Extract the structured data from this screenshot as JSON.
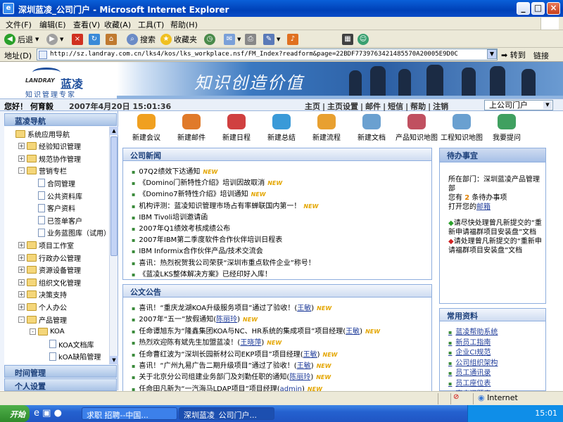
{
  "window": {
    "title": "深圳蓝凌_公司门户 - Microsoft Internet Explorer"
  },
  "menu": [
    "文件(F)",
    "编辑(E)",
    "查看(V)",
    "收藏(A)",
    "工具(T)",
    "帮助(H)"
  ],
  "toolbar": {
    "back": "后退",
    "search": "搜索",
    "favorites": "收藏夹"
  },
  "address": {
    "label": "地址(D)",
    "url": "http://sz.landray.com.cn/lks4/kos/lks_workplace.nsf/FM_Index?readform&page=22BDF7739763421485570A20005E9D0C",
    "go": "转到",
    "links": "链接"
  },
  "brand": {
    "logo_en": "LANDRAY",
    "logo_cn": "蓝凌",
    "tagline": "知识管理专家",
    "calligraphy": "知识创造价值"
  },
  "strip": {
    "greeting": "您好！ 何育毅",
    "datetime": "2007年4月20日 15:01:36",
    "nav": [
      "主页",
      "主页设置",
      "邮件",
      "短信",
      "帮助",
      "注销"
    ],
    "portal_select": "上公司门户"
  },
  "leftnav": {
    "header": "蓝凌导航",
    "footer1": "时间管理",
    "footer2": "个人设置",
    "tree": [
      {
        "label": "系统应用导航",
        "level": 0,
        "icon": "folder",
        "pm": ""
      },
      {
        "label": "经验知识管理",
        "level": 1,
        "icon": "folder",
        "pm": "+"
      },
      {
        "label": "规范协作管理",
        "level": 1,
        "icon": "folder",
        "pm": "+"
      },
      {
        "label": "营销专栏",
        "level": 1,
        "icon": "folder",
        "pm": "-"
      },
      {
        "label": "合同管理",
        "level": 2,
        "icon": "doc",
        "pm": ""
      },
      {
        "label": "公共资料库",
        "level": 2,
        "icon": "doc",
        "pm": ""
      },
      {
        "label": "客户资料",
        "level": 2,
        "icon": "doc",
        "pm": ""
      },
      {
        "label": "已签单客户",
        "level": 2,
        "icon": "doc",
        "pm": ""
      },
      {
        "label": "业务蓝图库（试用）",
        "level": 2,
        "icon": "doc",
        "pm": ""
      },
      {
        "label": "项目工作室",
        "level": 1,
        "icon": "folder",
        "pm": "+"
      },
      {
        "label": "行政办公管理",
        "level": 1,
        "icon": "folder",
        "pm": "+"
      },
      {
        "label": "资源设备管理",
        "level": 1,
        "icon": "folder",
        "pm": "+"
      },
      {
        "label": "组织文化管理",
        "level": 1,
        "icon": "folder",
        "pm": "+"
      },
      {
        "label": "决策支持",
        "level": 1,
        "icon": "folder",
        "pm": "+"
      },
      {
        "label": "个人办公",
        "level": 1,
        "icon": "folder",
        "pm": "+"
      },
      {
        "label": "产品管理",
        "level": 1,
        "icon": "folder",
        "pm": "-"
      },
      {
        "label": "KOA",
        "level": 2,
        "icon": "folder",
        "pm": "-"
      },
      {
        "label": "KOA文档库",
        "level": 3,
        "icon": "doc",
        "pm": ""
      },
      {
        "label": "kOA缺陷管理",
        "level": 3,
        "icon": "doc",
        "pm": ""
      }
    ]
  },
  "quick": [
    {
      "label": "新建会议",
      "color": "#f0a020"
    },
    {
      "label": "新建邮件",
      "color": "#e07a2a"
    },
    {
      "label": "新建日程",
      "color": "#d04040"
    },
    {
      "label": "新建总结",
      "color": "#3a9ad8"
    },
    {
      "label": "新建流程",
      "color": "#e8a030"
    },
    {
      "label": "新建文档",
      "color": "#6aa0d0"
    },
    {
      "label": "产品知识地图",
      "color": "#c05060"
    },
    {
      "label": "工程知识地图",
      "color": "#6aa0d0"
    },
    {
      "label": "我要提问",
      "color": "#40a060"
    }
  ],
  "news": {
    "title": "公司新闻",
    "items": [
      {
        "text": "07Q2绩效下达通知",
        "new": "NEW"
      },
      {
        "text": "《Domino门新特性介绍》培训因故取消",
        "new": "NEW"
      },
      {
        "text": "《Domino7新特性介绍》培训通知",
        "new": "NEW"
      },
      {
        "text": "机构评测：蓝凌知识管理市场占有率蝉联国内第一！",
        "new": "NEW"
      },
      {
        "text": "IBM Tivoli培训邀请函",
        "new": ""
      },
      {
        "text": "2007年Q1绩效考核成绩公布",
        "new": ""
      },
      {
        "text": "2007年IBM第二季度软件合作伙伴培训日程表",
        "new": ""
      },
      {
        "text": "IBM Informix合作伙伴产品/技术交流会",
        "new": ""
      },
      {
        "text": "喜讯：热烈祝贺我公司荣获“深圳市重点软件企业”称号！",
        "new": ""
      },
      {
        "text": "《蓝凌LKS整体解决方案》已经印好入库！",
        "new": ""
      }
    ]
  },
  "notices": {
    "title": "公文公告",
    "items": [
      {
        "text": "喜讯！“重庆龙湖KOA升级服务项目”通过了验收！",
        "user": "王敏",
        "new": "NEW"
      },
      {
        "text": "2007年“五一”放假通知",
        "user": "陈丽玲",
        "new": "NEW"
      },
      {
        "text": "任命谭旭东为“隆鑫集团KOA与NC、HR系统的集成项目”项目经理",
        "user": "王敏",
        "new": "NEW"
      },
      {
        "text": "热烈欢迎陈有斌先生加盟蓝凌！",
        "user": "王晓萍",
        "new": "NEW"
      },
      {
        "text": "任命曹红波为“深圳长园新材公司EKP项目”项目经理",
        "user": "王敏",
        "new": "NEW"
      },
      {
        "text": "喜讯！“广州九易广告二期升级项目”通过了验收！",
        "user": "王敏",
        "new": "NEW"
      },
      {
        "text": "关于北京分公司组建业务部门及刘勤任职的通知",
        "user": "陈丽玲",
        "new": "NEW"
      },
      {
        "text": "任命田凡新为“一汽海马LDAP项目”项目经理",
        "user": "admin",
        "new": "NEW"
      }
    ]
  },
  "todo": {
    "title": "待办事宜",
    "dept": "所在部门：深圳蓝凌产品管理部",
    "count_pre": "您有",
    "count": "2",
    "count_post": "条待办事项",
    "mail_pre": "打开您的",
    "mail_link": "邮箱",
    "items": [
      {
        "text": "请尽快处理曾凡新提交的“重新申请福群项目安装盘”文档",
        "bullet": "#2aa02a"
      },
      {
        "text": "请处理曾凡新提交的“重新申请福群项目安装盘”文档",
        "bullet": "#d02020"
      }
    ]
  },
  "common": {
    "title": "常用资料",
    "items": [
      "蓝凌帮助系统",
      "新员工指南",
      "企业CI规范",
      "公司组织架构",
      "员工通讯录",
      "员工座位表",
      "客户问题库"
    ]
  },
  "status": {
    "zone": "Internet"
  },
  "taskbar": {
    "start": "开始",
    "tasks": [
      "求职 招聘--中国...",
      "深圳蓝凌_公司门户..."
    ],
    "clock": "15:01"
  }
}
